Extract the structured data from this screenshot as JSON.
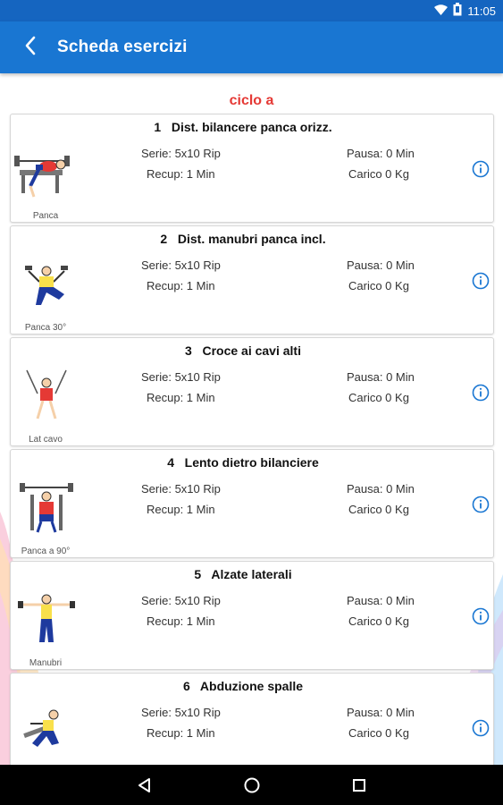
{
  "status_bar": {
    "time": "11:05",
    "icons": [
      "wifi-icon",
      "battery-icon"
    ]
  },
  "app_bar": {
    "title": "Scheda esercizi",
    "back_icon": "back-arrow-icon"
  },
  "section": {
    "title": "ciclo a"
  },
  "exercises": [
    {
      "number": "1",
      "name": "Dist. bilancere panca orizz.",
      "serie": "Serie: 5x10 Rip",
      "recup": "Recup: 1 Min",
      "pausa": "Pausa: 0 Min",
      "carico": "Carico 0 Kg",
      "equipment": "Panca"
    },
    {
      "number": "2",
      "name": "Dist. manubri panca incl.",
      "serie": "Serie: 5x10 Rip",
      "recup": "Recup: 1 Min",
      "pausa": "Pausa: 0 Min",
      "carico": "Carico 0 Kg",
      "equipment": "Panca 30°"
    },
    {
      "number": "3",
      "name": "Croce ai cavi alti",
      "serie": "Serie: 5x10 Rip",
      "recup": "Recup: 1 Min",
      "pausa": "Pausa: 0 Min",
      "carico": "Carico 0 Kg",
      "equipment": "Lat cavo"
    },
    {
      "number": "4",
      "name": "Lento dietro bilanciere",
      "serie": "Serie: 5x10 Rip",
      "recup": "Recup: 1 Min",
      "pausa": "Pausa: 0 Min",
      "carico": "Carico 0 Kg",
      "equipment": "Panca a 90°"
    },
    {
      "number": "5",
      "name": "Alzate laterali",
      "serie": "Serie: 5x10 Rip",
      "recup": "Recup: 1 Min",
      "pausa": "Pausa: 0 Min",
      "carico": "Carico 0 Kg",
      "equipment": "Manubri"
    },
    {
      "number": "6",
      "name": "Abduzione spalle",
      "serie": "Serie: 5x10 Rip",
      "recup": "Recup: 1 Min",
      "pausa": "Pausa: 0 Min",
      "carico": "Carico 0 Kg",
      "equipment": ""
    }
  ],
  "nav_bar": {
    "icons": [
      "nav-back-icon",
      "nav-home-icon",
      "nav-recents-icon"
    ]
  },
  "colors": {
    "app_bar": "#1976d2",
    "status_bar": "#1565c0",
    "section_title": "#e53935",
    "info_icon": "#1976d2"
  }
}
